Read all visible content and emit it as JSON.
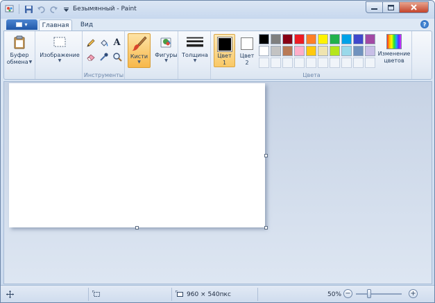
{
  "window": {
    "title": "Безымянный - Paint"
  },
  "tabs": [
    {
      "label": "Главная"
    },
    {
      "label": "Вид"
    }
  ],
  "ribbon": {
    "clipboard": {
      "label_line1": "Буфер",
      "label_line2": "обмена"
    },
    "image": {
      "label": "Изображение"
    },
    "tools": {
      "group_label": "Инструменты",
      "text_tool": "A"
    },
    "brushes": {
      "label": "Кисти"
    },
    "shapes": {
      "label": "Фигуры"
    },
    "thickness": {
      "label": "Толщина"
    },
    "colors": {
      "color1_label": "Цвет",
      "color1_num": "1",
      "color2_label": "Цвет",
      "color2_num": "2",
      "group_label": "Цвета",
      "edit_colors_line1": "Изменение",
      "edit_colors_line2": "цветов",
      "palette_row1": [
        "#000000",
        "#7f7f7f",
        "#880015",
        "#ed1c24",
        "#ff7f27",
        "#fff200",
        "#22b14c",
        "#00a2e8",
        "#3f48cc",
        "#a349a4"
      ],
      "palette_row2": [
        "#ffffff",
        "#c3c3c3",
        "#b97a57",
        "#ffaec9",
        "#ffc90e",
        "#efe4b0",
        "#b5e61d",
        "#99d9ea",
        "#7092be",
        "#c8bfe7"
      ],
      "primary_color": "#000000",
      "secondary_color": "#ffffff"
    }
  },
  "status": {
    "canvas_size": "960 × 540пкс",
    "zoom_level": "50%",
    "zoom_minus": "−",
    "zoom_plus": "+"
  }
}
